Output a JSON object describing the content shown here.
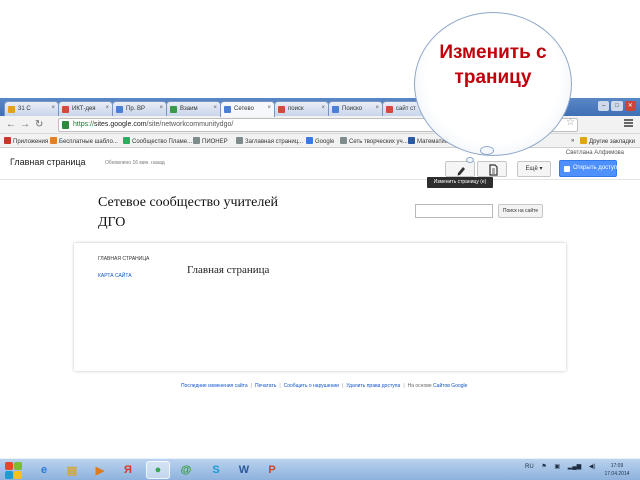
{
  "callout": {
    "text": "Изменить страницу"
  },
  "browser": {
    "tabs": [
      {
        "label": "31 С",
        "color": "#e3a21a"
      },
      {
        "label": "ИКТ-дея",
        "color": "#d24a3d"
      },
      {
        "label": "Пр. ВР",
        "color": "#4a7fd4"
      },
      {
        "label": "Взаим",
        "color": "#3a9a4a"
      },
      {
        "label": "Сетево",
        "color": "#4a7fd4",
        "active": true
      },
      {
        "label": "поиск",
        "color": "#d24a3d"
      },
      {
        "label": "Поиско",
        "color": "#4a7fd4"
      },
      {
        "label": "сайт ст",
        "color": "#d24a3d"
      },
      {
        "label": "Созда",
        "color": "#e3a21a"
      }
    ],
    "url_prefix": "https://",
    "url_host": "sites.google.com",
    "url_path": "/site/networkcommunitydgo/",
    "bookmarks": [
      {
        "label": "Приложения",
        "color": "#c0392b"
      },
      {
        "label": "Бесплатные шабло...",
        "color": "#e67e22"
      },
      {
        "label": "Сообщество Пламе...",
        "color": "#27ae60"
      },
      {
        "label": "ПИОНЕР",
        "color": "#7f8c8d"
      },
      {
        "label": "Заглавная страниц...",
        "color": "#7f8c8d"
      },
      {
        "label": "Google",
        "color": "#3b78e7"
      },
      {
        "label": "Сеть творческих уч...",
        "color": "#7f8c8d"
      },
      {
        "label": "Математика",
        "color": "#2c5aa0"
      },
      {
        "label": "Другие закладки",
        "color": "#e3a21a"
      }
    ],
    "more_bookmarks": "»"
  },
  "sites": {
    "user_name": "Светлана Алфимова",
    "page_title": "Главная страница",
    "page_meta": "Обновлено 16 мин. назад",
    "more_label": "Ещё",
    "share_label": "Открыть доступ",
    "edit_tooltip": "Изменить страницу (e)",
    "site_name": "Сетевое сообщество учителей ДГО",
    "search_button": "Поиск на сайте",
    "nav_home": "ГЛАВНАЯ СТРАНИЦА",
    "nav_sitemap": "КАРТА САЙТА",
    "heading": "Главная страница",
    "footer": {
      "report": "Последние изменения сайта",
      "print": "Печатать",
      "report_abuse": "Сообщить о нарушении",
      "remove_access": "Удалить права доступа",
      "powered_prefix": "На основе",
      "powered_link": "Сайтов Google"
    }
  },
  "taskbar": {
    "apps": [
      {
        "name": "ie",
        "glyph": "e",
        "color": "#2a7ad4"
      },
      {
        "name": "explorer",
        "glyph": "▤",
        "color": "#d9a52a"
      },
      {
        "name": "media-player",
        "glyph": "▶",
        "color": "#e07a1f"
      },
      {
        "name": "yandex",
        "glyph": "Я",
        "color": "#d43a2a"
      },
      {
        "name": "chrome",
        "glyph": "●",
        "color": "#3aa757"
      },
      {
        "name": "e-client",
        "glyph": "@",
        "color": "#2e9a3a"
      },
      {
        "name": "skype",
        "glyph": "S",
        "color": "#1a9ad6"
      },
      {
        "name": "word",
        "glyph": "W",
        "color": "#2b579a"
      },
      {
        "name": "powerpoint",
        "glyph": "P",
        "color": "#c9472a"
      }
    ],
    "lang": "RU",
    "time": "17:09",
    "date": "17.04.2014"
  }
}
